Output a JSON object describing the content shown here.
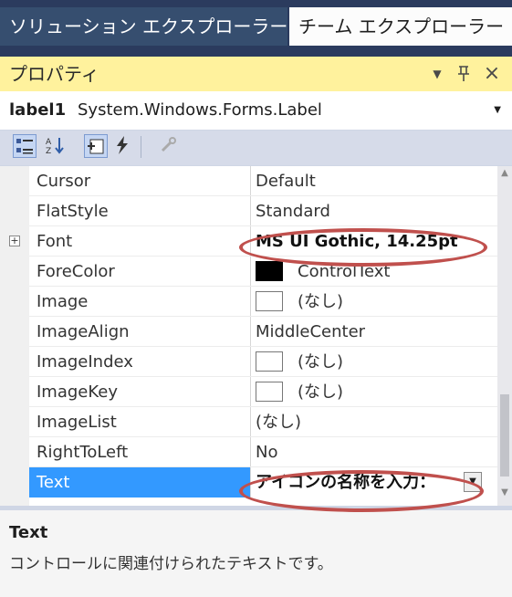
{
  "tabs": [
    {
      "label": "ソリューション エクスプローラー"
    },
    {
      "label": "チーム エクスプローラー"
    }
  ],
  "panel": {
    "title": "プロパティ",
    "dropdown_icon": "triangle-down-icon",
    "pin_icon": "pin-icon",
    "close_icon": "close-icon"
  },
  "object_selector": {
    "name": "label1",
    "type": "System.Windows.Forms.Label"
  },
  "properties": [
    {
      "name": "Cursor",
      "value": "Default"
    },
    {
      "name": "FlatStyle",
      "value": "Standard"
    },
    {
      "name": "Font",
      "value": "MS UI Gothic, 14.25pt"
    },
    {
      "name": "ForeColor",
      "value": "ControlText"
    },
    {
      "name": "Image",
      "value": "(なし)"
    },
    {
      "name": "ImageAlign",
      "value": "MiddleCenter"
    },
    {
      "name": "ImageIndex",
      "value": "(なし)"
    },
    {
      "name": "ImageKey",
      "value": "(なし)"
    },
    {
      "name": "ImageList",
      "value": "(なし)"
    },
    {
      "name": "RightToLeft",
      "value": "No"
    },
    {
      "name": "Text",
      "value": "アイコンの名称を入力："
    }
  ],
  "description": {
    "title": "Text",
    "text": "コントロールに関連付けられたテキストです。"
  },
  "colors": {
    "tab_active_bg": "#fcfcfc",
    "tab_inactive_bg": "#364e6f",
    "title_bg": "#fff29d",
    "selection_bg": "#3399ff",
    "annotation": "#c0504d"
  }
}
